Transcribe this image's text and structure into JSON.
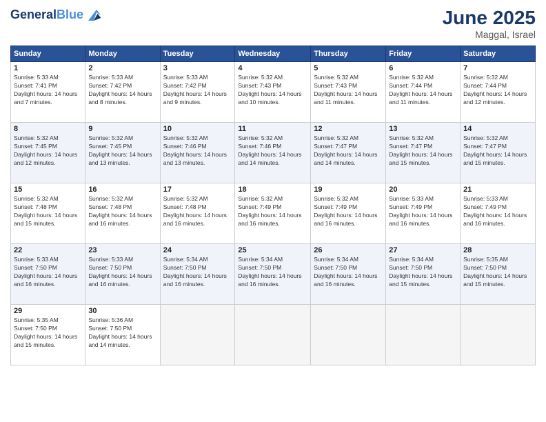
{
  "logo": {
    "line1": "General",
    "line2": "Blue"
  },
  "title": "June 2025",
  "subtitle": "Maggal, Israel",
  "weekdays": [
    "Sunday",
    "Monday",
    "Tuesday",
    "Wednesday",
    "Thursday",
    "Friday",
    "Saturday"
  ],
  "weeks": [
    [
      {
        "day": "1",
        "sunrise": "5:33 AM",
        "sunset": "7:41 PM",
        "daylight": "14 hours and 7 minutes."
      },
      {
        "day": "2",
        "sunrise": "5:33 AM",
        "sunset": "7:42 PM",
        "daylight": "14 hours and 8 minutes."
      },
      {
        "day": "3",
        "sunrise": "5:33 AM",
        "sunset": "7:42 PM",
        "daylight": "14 hours and 9 minutes."
      },
      {
        "day": "4",
        "sunrise": "5:32 AM",
        "sunset": "7:43 PM",
        "daylight": "14 hours and 10 minutes."
      },
      {
        "day": "5",
        "sunrise": "5:32 AM",
        "sunset": "7:43 PM",
        "daylight": "14 hours and 11 minutes."
      },
      {
        "day": "6",
        "sunrise": "5:32 AM",
        "sunset": "7:44 PM",
        "daylight": "14 hours and 11 minutes."
      },
      {
        "day": "7",
        "sunrise": "5:32 AM",
        "sunset": "7:44 PM",
        "daylight": "14 hours and 12 minutes."
      }
    ],
    [
      {
        "day": "8",
        "sunrise": "5:32 AM",
        "sunset": "7:45 PM",
        "daylight": "14 hours and 12 minutes."
      },
      {
        "day": "9",
        "sunrise": "5:32 AM",
        "sunset": "7:45 PM",
        "daylight": "14 hours and 13 minutes."
      },
      {
        "day": "10",
        "sunrise": "5:32 AM",
        "sunset": "7:46 PM",
        "daylight": "14 hours and 13 minutes."
      },
      {
        "day": "11",
        "sunrise": "5:32 AM",
        "sunset": "7:46 PM",
        "daylight": "14 hours and 14 minutes."
      },
      {
        "day": "12",
        "sunrise": "5:32 AM",
        "sunset": "7:47 PM",
        "daylight": "14 hours and 14 minutes."
      },
      {
        "day": "13",
        "sunrise": "5:32 AM",
        "sunset": "7:47 PM",
        "daylight": "14 hours and 15 minutes."
      },
      {
        "day": "14",
        "sunrise": "5:32 AM",
        "sunset": "7:47 PM",
        "daylight": "14 hours and 15 minutes."
      }
    ],
    [
      {
        "day": "15",
        "sunrise": "5:32 AM",
        "sunset": "7:48 PM",
        "daylight": "14 hours and 15 minutes."
      },
      {
        "day": "16",
        "sunrise": "5:32 AM",
        "sunset": "7:48 PM",
        "daylight": "14 hours and 16 minutes."
      },
      {
        "day": "17",
        "sunrise": "5:32 AM",
        "sunset": "7:48 PM",
        "daylight": "14 hours and 16 minutes."
      },
      {
        "day": "18",
        "sunrise": "5:32 AM",
        "sunset": "7:49 PM",
        "daylight": "14 hours and 16 minutes."
      },
      {
        "day": "19",
        "sunrise": "5:32 AM",
        "sunset": "7:49 PM",
        "daylight": "14 hours and 16 minutes."
      },
      {
        "day": "20",
        "sunrise": "5:33 AM",
        "sunset": "7:49 PM",
        "daylight": "14 hours and 16 minutes."
      },
      {
        "day": "21",
        "sunrise": "5:33 AM",
        "sunset": "7:49 PM",
        "daylight": "14 hours and 16 minutes."
      }
    ],
    [
      {
        "day": "22",
        "sunrise": "5:33 AM",
        "sunset": "7:50 PM",
        "daylight": "14 hours and 16 minutes."
      },
      {
        "day": "23",
        "sunrise": "5:33 AM",
        "sunset": "7:50 PM",
        "daylight": "14 hours and 16 minutes."
      },
      {
        "day": "24",
        "sunrise": "5:34 AM",
        "sunset": "7:50 PM",
        "daylight": "14 hours and 16 minutes."
      },
      {
        "day": "25",
        "sunrise": "5:34 AM",
        "sunset": "7:50 PM",
        "daylight": "14 hours and 16 minutes."
      },
      {
        "day": "26",
        "sunrise": "5:34 AM",
        "sunset": "7:50 PM",
        "daylight": "14 hours and 16 minutes."
      },
      {
        "day": "27",
        "sunrise": "5:34 AM",
        "sunset": "7:50 PM",
        "daylight": "14 hours and 15 minutes."
      },
      {
        "day": "28",
        "sunrise": "5:35 AM",
        "sunset": "7:50 PM",
        "daylight": "14 hours and 15 minutes."
      }
    ],
    [
      {
        "day": "29",
        "sunrise": "5:35 AM",
        "sunset": "7:50 PM",
        "daylight": "14 hours and 15 minutes."
      },
      {
        "day": "30",
        "sunrise": "5:36 AM",
        "sunset": "7:50 PM",
        "daylight": "14 hours and 14 minutes."
      },
      null,
      null,
      null,
      null,
      null
    ]
  ],
  "labels": {
    "sunrise": "Sunrise:",
    "sunset": "Sunset:",
    "daylight": "Daylight hours"
  }
}
